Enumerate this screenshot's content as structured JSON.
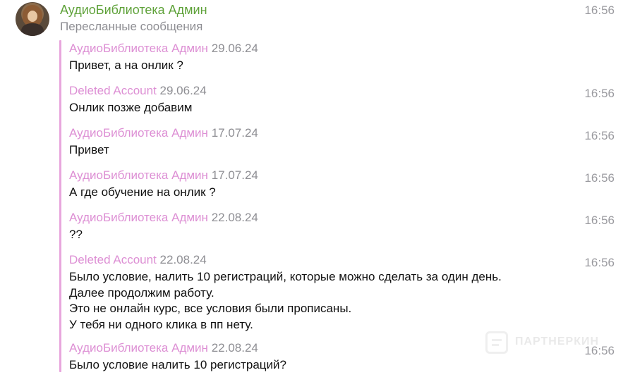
{
  "header": {
    "sender_name": "АудиоБиблиотека Админ",
    "forward_label": "Пересланные сообщения",
    "time": "16:56"
  },
  "messages": [
    {
      "author": "АудиоБиблиотека Админ",
      "date": "29.06.24",
      "lines": [
        "Привет, а на онлик ?"
      ],
      "time": ""
    },
    {
      "author": "Deleted Account",
      "date": "29.06.24",
      "lines": [
        "Онлик позже добавим"
      ],
      "time": "16:56"
    },
    {
      "author": "АудиоБиблиотека Админ",
      "date": "17.07.24",
      "lines": [
        "Привет"
      ],
      "time": "16:56"
    },
    {
      "author": "АудиоБиблиотека Админ",
      "date": "17.07.24",
      "lines": [
        "А где обучение на онлик ?"
      ],
      "time": "16:56"
    },
    {
      "author": "АудиоБиблиотека Админ",
      "date": "22.08.24",
      "lines": [
        "??"
      ],
      "time": "16:56"
    },
    {
      "author": "Deleted Account",
      "date": "22.08.24",
      "lines": [
        "Было условие, налить 10 регистраций, которые можно сделать за один день.",
        "Далее продолжим работу.",
        "Это не онлайн курс, все условия были прописаны.",
        "У тебя ни одного клика в пп нету."
      ],
      "time": "16:56"
    },
    {
      "author": "АудиоБиблиотека Админ",
      "date": "22.08.24",
      "lines": [
        "Было условие налить 10 регистраций?"
      ],
      "time": "16:56"
    }
  ],
  "watermark": {
    "text": "ПАРТНЕРКИН",
    "icon": "chat-bubble-icon"
  },
  "colors": {
    "sender_name": "#5fa23a",
    "forwarded_author": "#dd8fd4",
    "forward_bar": "#e8a6dd",
    "meta_gray": "#8e8e93"
  }
}
